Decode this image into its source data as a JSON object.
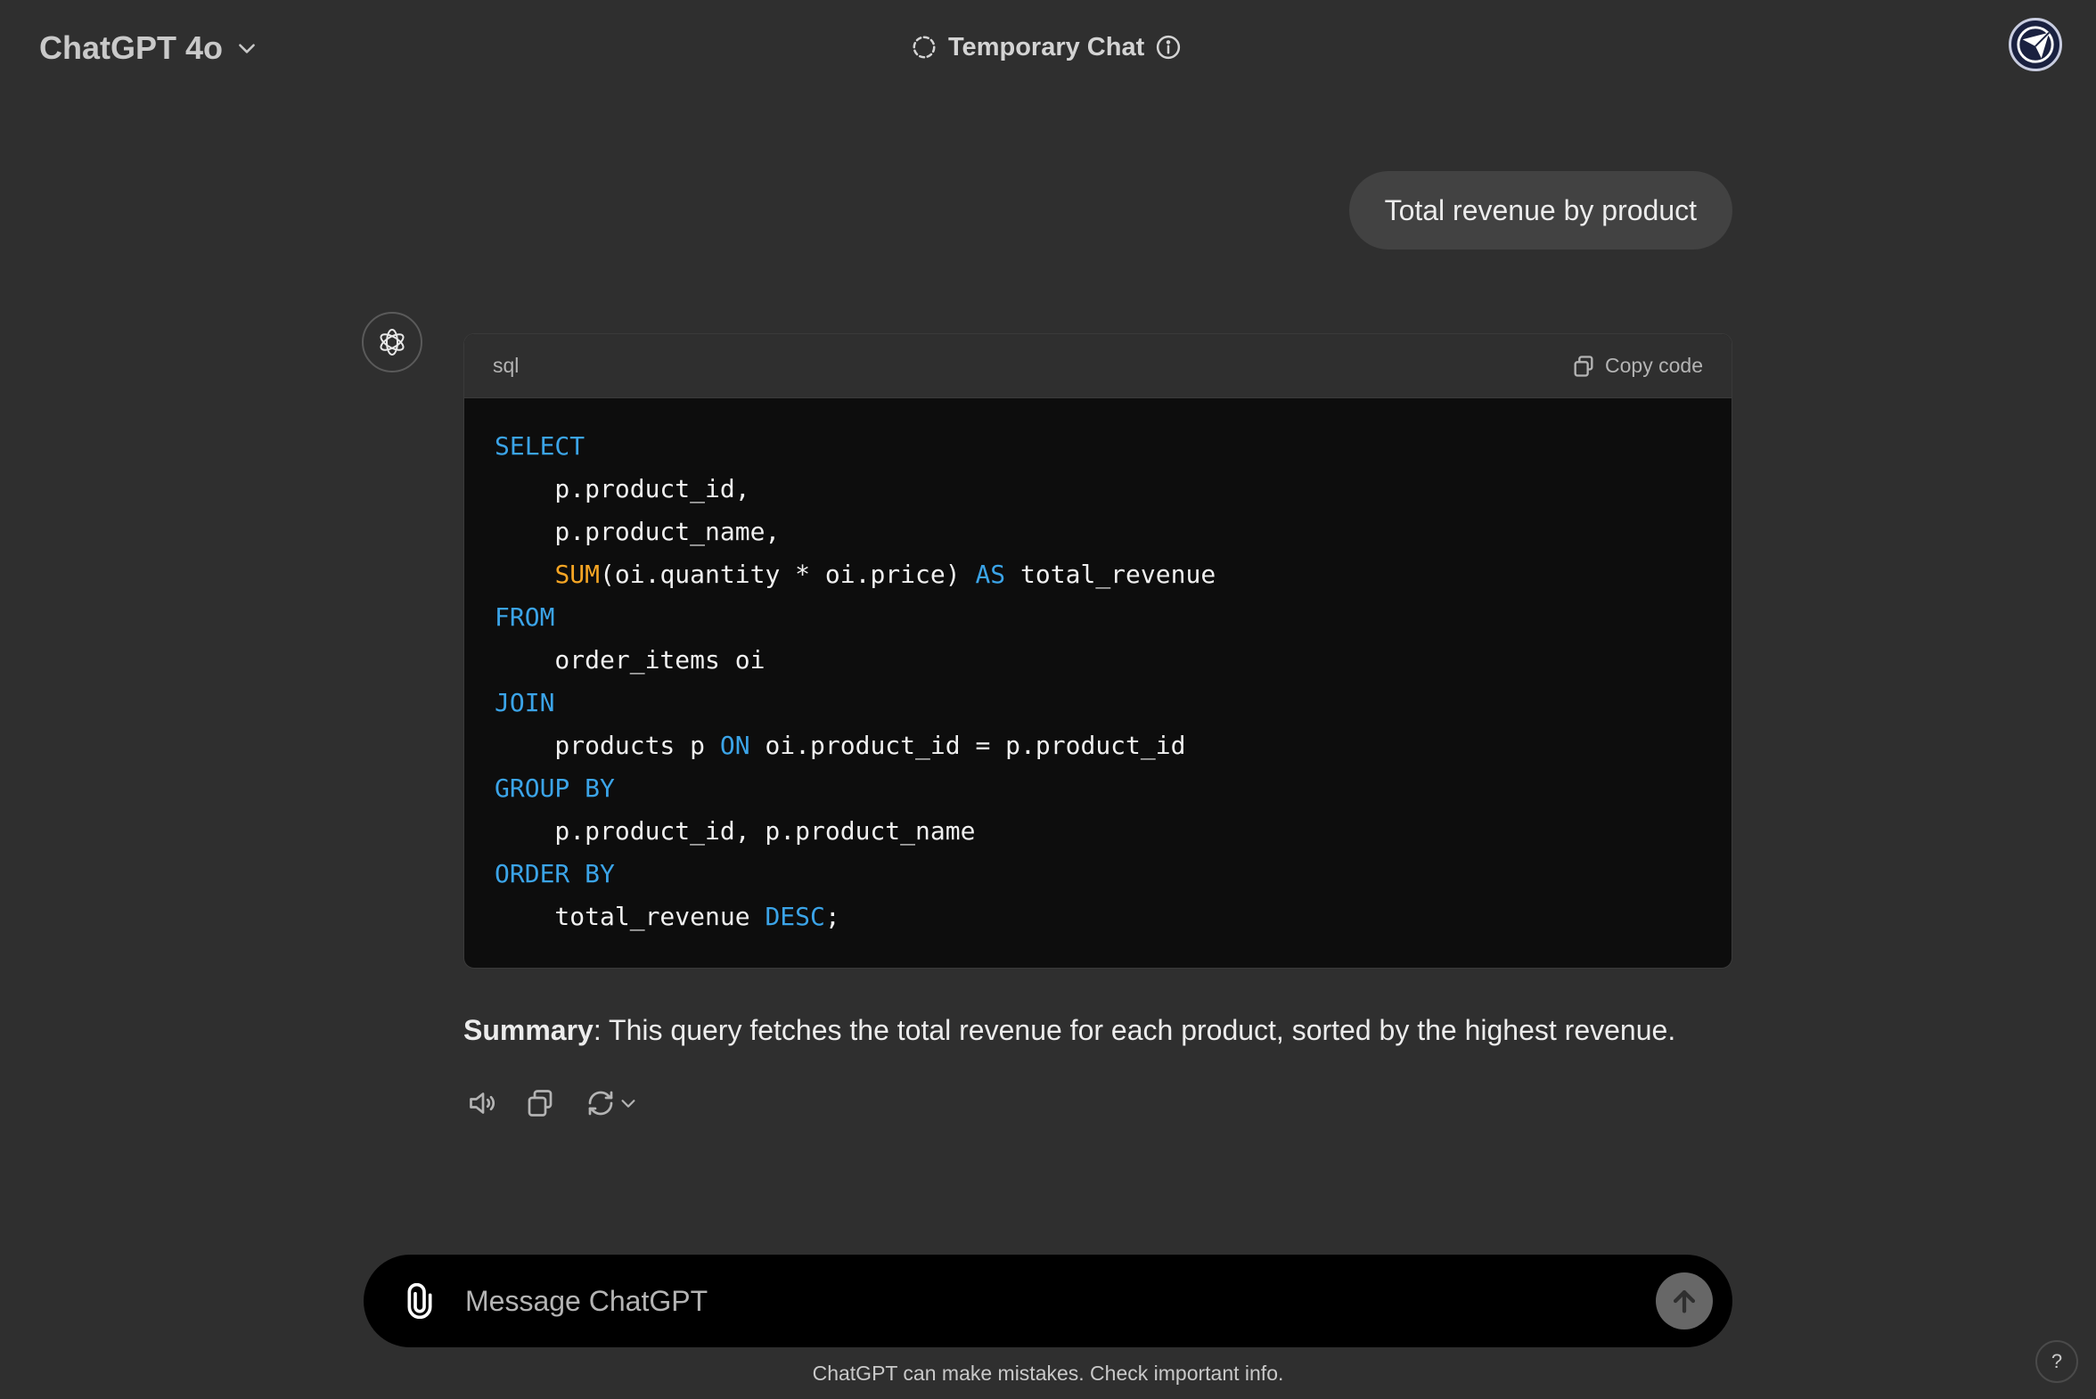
{
  "header": {
    "model_label": "ChatGPT 4o",
    "temporary_chat_label": "Temporary Chat"
  },
  "conversation": {
    "user_message": "Total revenue by product",
    "code_block": {
      "language": "sql",
      "copy_label": "Copy code",
      "lines": [
        [
          {
            "t": "SELECT",
            "c": "kw"
          }
        ],
        [
          {
            "t": "    p.product_id,"
          }
        ],
        [
          {
            "t": "    p.product_name,"
          }
        ],
        [
          {
            "t": "    "
          },
          {
            "t": "SUM",
            "c": "fn"
          },
          {
            "t": "(oi.quantity * oi.price) "
          },
          {
            "t": "AS",
            "c": "kw"
          },
          {
            "t": " total_revenue"
          }
        ],
        [
          {
            "t": "FROM",
            "c": "kw"
          }
        ],
        [
          {
            "t": "    order_items oi"
          }
        ],
        [
          {
            "t": "JOIN",
            "c": "kw"
          }
        ],
        [
          {
            "t": "    products p "
          },
          {
            "t": "ON",
            "c": "kw"
          },
          {
            "t": " oi.product_id = p.product_id"
          }
        ],
        [
          {
            "t": "GROUP BY",
            "c": "kw"
          }
        ],
        [
          {
            "t": "    p.product_id, p.product_name"
          }
        ],
        [
          {
            "t": "ORDER BY",
            "c": "kw"
          }
        ],
        [
          {
            "t": "    total_revenue "
          },
          {
            "t": "DESC",
            "c": "kw"
          },
          {
            "t": ";"
          }
        ]
      ]
    },
    "summary_label": "Summary",
    "summary_text": ": This query fetches the total revenue for each product, sorted by the highest revenue."
  },
  "composer": {
    "placeholder": "Message ChatGPT"
  },
  "footer": {
    "disclaimer": "ChatGPT can make mistakes. Check important info.",
    "help_label": "?"
  },
  "icons": {
    "model_dropdown": "chevron-down-icon",
    "temporary_chat": "dashed-circle-icon",
    "info": "info-icon",
    "profile": "profile-avatar-icon",
    "assistant": "openai-logo-icon",
    "copy": "copy-icon",
    "read_aloud": "speaker-icon",
    "regenerate": "refresh-icon",
    "attach": "paperclip-icon",
    "send": "arrow-up-icon"
  },
  "colors": {
    "background": "#2f2f2f",
    "code_background": "#0d0d0d",
    "keyword": "#3ba4e8",
    "function": "#f5a524",
    "composer": "#000000"
  }
}
